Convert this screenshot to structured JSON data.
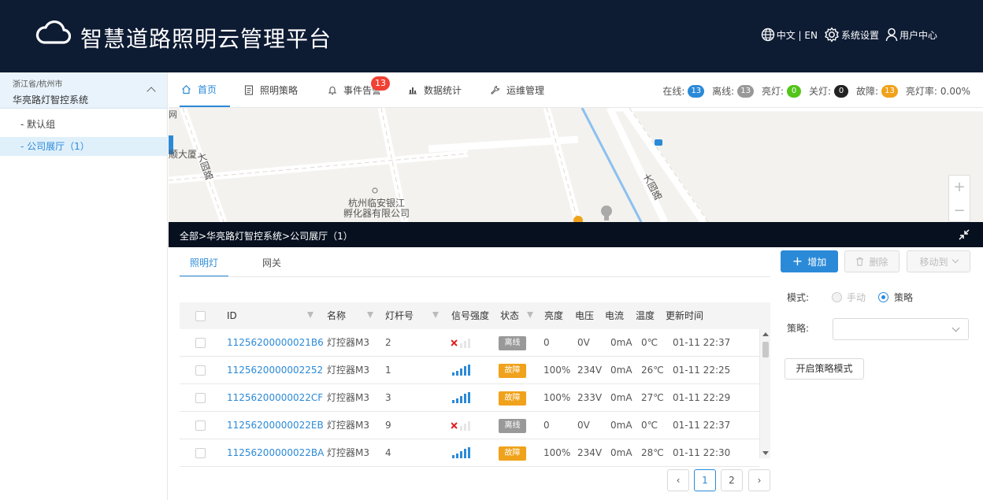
{
  "header": {
    "title": "智慧道路照明云管理平台",
    "lang": "中文 | EN",
    "settings": "系统设置",
    "user_center": "用户中心",
    "logo_icon": "cloud-icon"
  },
  "sidebar": {
    "region": "浙江省/杭州市",
    "system": "华亮路灯智控系统",
    "items": [
      {
        "label": "- 默认组"
      },
      {
        "label": "- 公司展厅（1）"
      }
    ]
  },
  "nav": {
    "tabs": [
      {
        "label": "首页",
        "icon": "home-icon"
      },
      {
        "label": "照明策略",
        "icon": "document-icon"
      },
      {
        "label": "事件告警",
        "icon": "bell-icon"
      },
      {
        "label": "数据统计",
        "icon": "bar-chart-icon"
      },
      {
        "label": "运维管理",
        "icon": "wrench-icon"
      }
    ],
    "alarm_count": "13"
  },
  "status": {
    "online_label": "在线:",
    "online": "13",
    "offline_label": "离线:",
    "offline": "13",
    "on_label": "亮灯:",
    "on": "0",
    "off_label": "关灯:",
    "off": "0",
    "fault_label": "故障:",
    "fault": "13",
    "rate_label": "亮灯率:",
    "rate": "0.00%"
  },
  "map": {
    "labels": [
      "网",
      "顺大厦",
      "大园路",
      "大园路",
      "杭州临安银江",
      "孵化器有限公司"
    ],
    "zoom_in": "+",
    "zoom_out": "−"
  },
  "breadcrumb": "全部>华亮路灯智控系统>公司展厅（1）",
  "sub_tabs": [
    {
      "label": "照明灯"
    },
    {
      "label": "网关"
    }
  ],
  "toolbar": {
    "add": "增加",
    "delete": "删除",
    "move": "移动到"
  },
  "table": {
    "columns": [
      "ID",
      "名称",
      "灯杆号",
      "信号强度",
      "状态",
      "亮度",
      "电压",
      "电流",
      "温度",
      "更新时间"
    ],
    "rows": [
      {
        "id": "11256200000021B6",
        "name": "灯控器M3",
        "pole": "2",
        "signal": "none",
        "state": "离线",
        "brightness": "0",
        "voltage": "0V",
        "current": "0mA",
        "temp": "0℃",
        "time": "01-11 22:37"
      },
      {
        "id": "1125620000002252",
        "name": "灯控器M3",
        "pole": "1",
        "signal": "full",
        "state": "故障",
        "brightness": "100%",
        "voltage": "234V",
        "current": "0mA",
        "temp": "26℃",
        "time": "01-11 22:25"
      },
      {
        "id": "11256200000022CF",
        "name": "灯控器M3",
        "pole": "3",
        "signal": "full",
        "state": "故障",
        "brightness": "100%",
        "voltage": "233V",
        "current": "0mA",
        "temp": "27℃",
        "time": "01-11 22:29"
      },
      {
        "id": "11256200000022EB",
        "name": "灯控器M3",
        "pole": "9",
        "signal": "none",
        "state": "离线",
        "brightness": "0",
        "voltage": "0V",
        "current": "0mA",
        "temp": "0℃",
        "time": "01-11 22:37"
      },
      {
        "id": "11256200000022BA",
        "name": "灯控器M3",
        "pole": "4",
        "signal": "full",
        "state": "故障",
        "brightness": "100%",
        "voltage": "234V",
        "current": "0mA",
        "temp": "28℃",
        "time": "01-11 22:30"
      }
    ]
  },
  "pagination": {
    "prev": "‹",
    "pages": [
      "1",
      "2"
    ],
    "next": "›",
    "current": "1"
  },
  "panel": {
    "mode_label": "模式:",
    "manual": "手动",
    "strategy": "策略",
    "strategy_label": "策略:",
    "strategy_value": "",
    "enable": "开启策略模式"
  },
  "colors": {
    "header_bg": "#0d1b33",
    "accent": "#2b8ad8",
    "offline": "#999999",
    "fault": "#f0a21b",
    "on": "#52c41a",
    "off": "#222222",
    "alarm": "#f04134"
  }
}
